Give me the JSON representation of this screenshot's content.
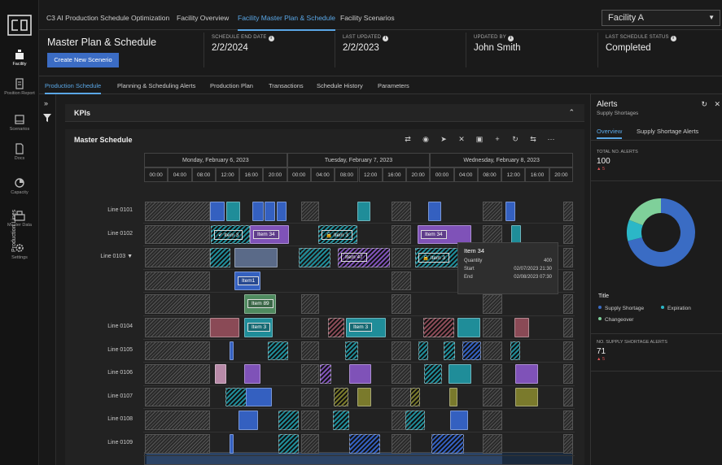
{
  "app": {
    "title": "C3 AI Production Schedule Optimization",
    "nav_tabs": [
      "Facility Overview",
      "Facility Master Plan & Schedule",
      "Facility Scenarios"
    ],
    "facility": "Facility A"
  },
  "rail": [
    {
      "label": "Facility",
      "icon": "factory-icon"
    },
    {
      "label": "Position Report",
      "icon": "report-icon"
    },
    {
      "label": "Scenarios",
      "icon": "scenarios-icon"
    },
    {
      "label": "Docs",
      "icon": "doc-icon"
    },
    {
      "label": "Capacity",
      "icon": "capacity-icon"
    },
    {
      "label": "Master Data",
      "icon": "master-data-icon"
    },
    {
      "label": "Settings",
      "icon": "gear-icon"
    }
  ],
  "header": {
    "title": "Master Plan & Schedule",
    "create_button": "Create New Scenerio",
    "info": [
      {
        "label": "SCHEDULE END DATE",
        "value": "2/2/2024"
      },
      {
        "label": "LAST UPDATED",
        "value": "2/2/2023"
      },
      {
        "label": "UPDATED BY",
        "value": "John Smith"
      },
      {
        "label": "LAST SCHEDULE STATUS",
        "value": "Completed"
      }
    ]
  },
  "subtabs": [
    "Production Schedule",
    "Planning & Scheduling Alerts",
    "Production Plan",
    "Transactions",
    "Schedule History",
    "Parameters"
  ],
  "kpis": {
    "title": "KPIs"
  },
  "schedule": {
    "title": "Master Schedule",
    "days": [
      "Monday, February 6, 2023",
      "Tuesday, February 7, 2023",
      "Wednesday, February 8, 2023"
    ],
    "hours": [
      "00:00",
      "04:00",
      "08:00",
      "12:00",
      "16:00",
      "20:00"
    ],
    "lines_label": "Production Lines",
    "lines": [
      "Line 0101",
      "Line 0102",
      "Line 0103 ▼",
      "",
      "",
      "Line 0104",
      "Line 0105",
      "Line 0106",
      "Line 0107",
      "Line 0108",
      "Line 0109"
    ],
    "labels": {
      "item3a": "✔ Item 3",
      "item34a": "Item 34",
      "item3b": "🔒 Item 3",
      "item34b": "Item 34",
      "item47": "Item 47",
      "item3c": "🔒 Item 3",
      "item1": "Item1",
      "item89": "Item 89",
      "item3d": "Item 3",
      "item3e": "Item 3"
    },
    "tooltip": {
      "title": "Item 34",
      "rows": [
        {
          "k": "Quantity",
          "v": "400"
        },
        {
          "k": "Start",
          "v": "02/07/2023 21:30"
        },
        {
          "k": "End",
          "v": "02/08/2023 07:30"
        }
      ]
    }
  },
  "alerts": {
    "title": "Alerts",
    "subtitle": "Supply Shortages",
    "tabs": [
      "Overview",
      "Supply Shortage Alerts"
    ],
    "total_label": "TOTAL NO. ALERTS",
    "total_value": "100",
    "total_delta": "▲ 5",
    "legend_title": "Title",
    "legend": [
      {
        "name": "Supply Shortage",
        "color": "#3a6cc4",
        "value": 71
      },
      {
        "name": "Expiration",
        "color": "#2bb7c7",
        "value": 10
      },
      {
        "name": "Changeover",
        "color": "#7fd09a",
        "value": 19
      }
    ],
    "supply_label": "NO. SUPPLY SHORTAGE ALERTS",
    "supply_value": "71",
    "supply_delta": "▲ 5"
  }
}
